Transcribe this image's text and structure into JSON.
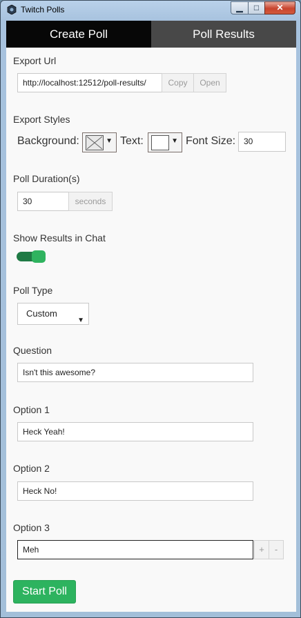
{
  "window": {
    "title": "Twitch Polls",
    "min_glyph": "▁",
    "max_glyph": "□",
    "close_glyph": "✕"
  },
  "tabs": [
    {
      "label": "Create Poll",
      "active": true
    },
    {
      "label": "Poll Results",
      "active": false
    }
  ],
  "export_url": {
    "label": "Export Url",
    "value": "http://localhost:12512/poll-results/",
    "copy_label": "Copy",
    "open_label": "Open"
  },
  "export_styles": {
    "label": "Export Styles",
    "background_label": "Background:",
    "text_label": "Text:",
    "font_size_label": "Font Size:",
    "font_size_value": "30",
    "background_color": "transparent",
    "text_color": "#ffffff"
  },
  "duration": {
    "label": "Poll Duration(s)",
    "value": "30",
    "unit": "seconds"
  },
  "show_results": {
    "label": "Show Results in Chat",
    "enabled": true
  },
  "poll_type": {
    "label": "Poll Type",
    "selected": "Custom"
  },
  "question": {
    "label": "Question",
    "value": "Isn't this awesome?"
  },
  "options": [
    {
      "label": "Option 1",
      "value": "Heck Yeah!"
    },
    {
      "label": "Option 2",
      "value": "Heck No!"
    },
    {
      "label": "Option 3",
      "value": "Meh"
    }
  ],
  "option_controls": {
    "add_label": "+",
    "remove_label": "-"
  },
  "start_button": "Start Poll",
  "colors": {
    "accent": "#2db35f",
    "tab_active": "#070707",
    "tab_inactive": "#484848"
  }
}
